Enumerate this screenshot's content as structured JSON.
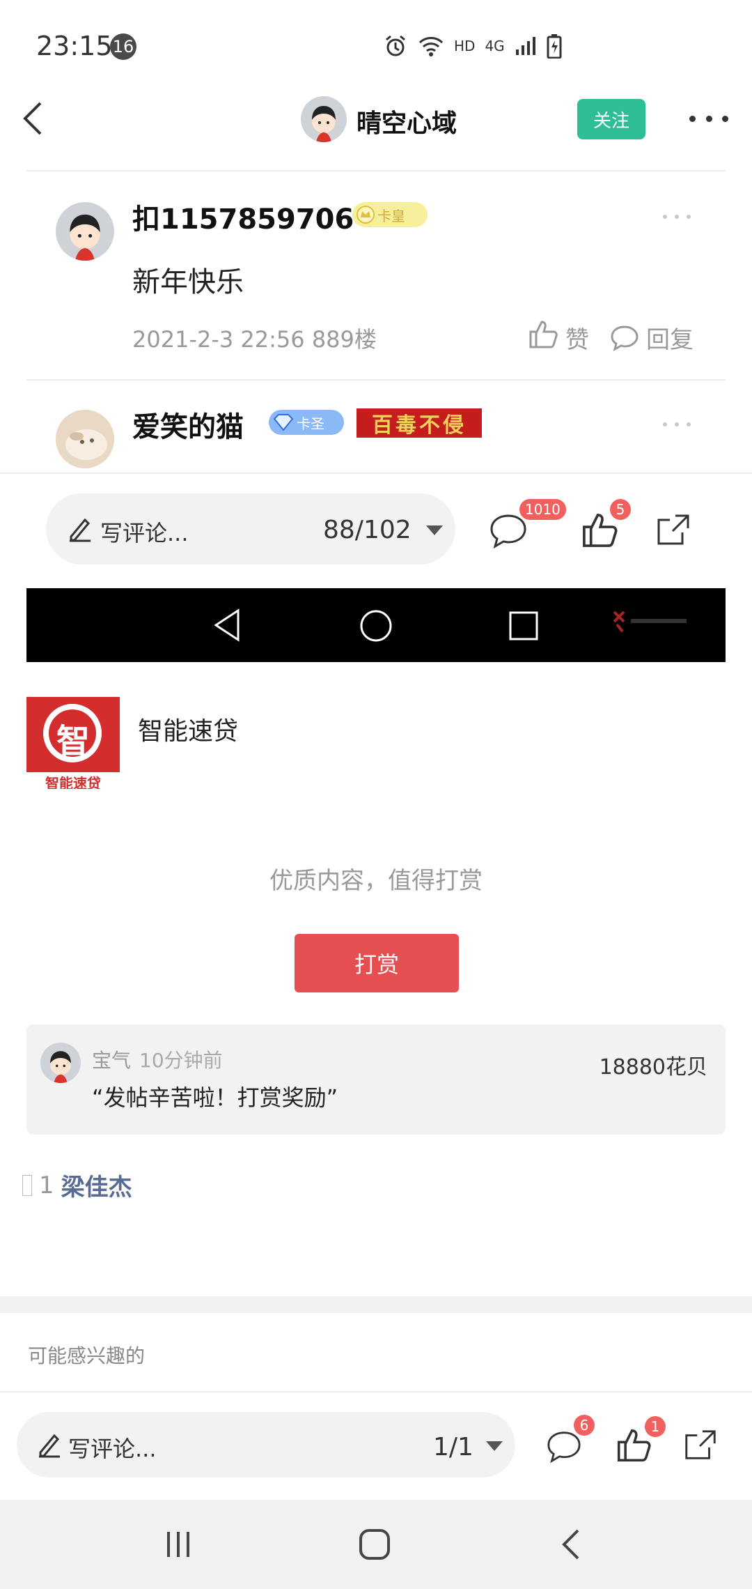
{
  "status_bar": {
    "time": "23:15",
    "notification_count": "16",
    "network_label": "HD",
    "cell_label": "4G"
  },
  "header": {
    "title": "晴空心域",
    "follow_label": "关注"
  },
  "posts": [
    {
      "username": "扣1157859706",
      "badge": "卡皇",
      "text": "新年快乐",
      "meta": "2021-2-3 22:56  889楼",
      "like_label": "赞",
      "reply_label": "回复"
    },
    {
      "username": "爱笑的猫",
      "badge": "卡圣",
      "title_badge": "百毒不侵"
    }
  ],
  "toolbar_top": {
    "placeholder": "写评论...",
    "page": "88/102",
    "comment_count": "1010",
    "like_count": "5"
  },
  "ad": {
    "logo_char": "智",
    "logo_caption": "智能速贷",
    "name": "智能速贷"
  },
  "reward": {
    "tip": "优质内容，值得打赏",
    "button_label": "打赏",
    "card": {
      "user": "宝气",
      "time": "10分钟前",
      "message": "“发帖辛苦啦！打赏奖励”",
      "amount": "18880花贝"
    }
  },
  "likes": {
    "count": "1",
    "user": "梁佳杰"
  },
  "interest_title": "可能感兴趣的",
  "toolbar_bottom": {
    "placeholder": "写评论...",
    "page": "1/1",
    "comment_count": "6",
    "like_count": "1"
  },
  "colors": {
    "accent_green": "#2dbd97",
    "reward_red": "#e64f51",
    "count_red": "#f1605f",
    "link_blue": "#576b95"
  }
}
